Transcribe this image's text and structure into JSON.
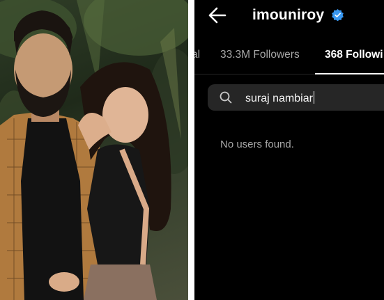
{
  "profile": {
    "username": "imouniroy",
    "verified": true,
    "accent_color": "#3897f0",
    "back_icon": "arrow-left-icon"
  },
  "tabs": [
    {
      "label": "al",
      "active": false
    },
    {
      "label": "33.3M Followers",
      "active": false
    },
    {
      "label": "368 Followi",
      "active": true
    }
  ],
  "search": {
    "icon": "search-icon",
    "value": "suraj nambiar"
  },
  "results": {
    "empty_message": "No users found."
  },
  "photo": {
    "description_icon": "couple-photo"
  }
}
